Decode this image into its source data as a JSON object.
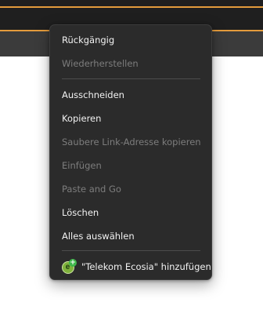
{
  "context_menu": {
    "items": [
      {
        "label": "Rückgängig",
        "enabled": true
      },
      {
        "label": "Wiederherstellen",
        "enabled": false
      },
      {
        "label": "Ausschneiden",
        "enabled": true
      },
      {
        "label": "Kopieren",
        "enabled": true
      },
      {
        "label": "Saubere Link-Adresse kopieren",
        "enabled": false
      },
      {
        "label": "Einfügen",
        "enabled": false
      },
      {
        "label": "Paste and Go",
        "enabled": false
      },
      {
        "label": "Löschen",
        "enabled": true
      },
      {
        "label": "Alles auswählen",
        "enabled": true
      }
    ],
    "extension_item": {
      "label": "\"Telekom Ecosia\" hinzufügen",
      "icon": "ecosia-add-icon"
    }
  },
  "colors": {
    "menu_background": "#2b2b2b",
    "enabled_text": "#f2f2f2",
    "disabled_text": "#7d7d7d",
    "toolbar_accent": "#e39b3c"
  }
}
